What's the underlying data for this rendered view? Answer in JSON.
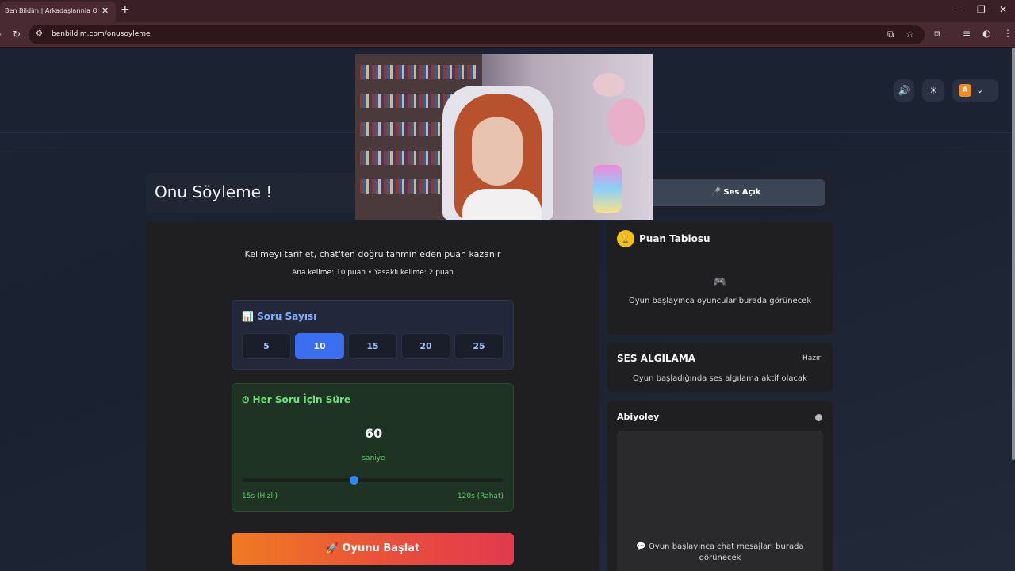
{
  "browser": {
    "tab_title": "Ben Bildim | Arkadaşlarınla Onl",
    "tab_close": "✕",
    "new_tab": "+",
    "url": "benbildim.com/onusoyleme",
    "minimize": "—",
    "maximize": "❐",
    "close": "✕"
  },
  "header": {
    "volume_icon": "🔊",
    "theme_icon": "☀",
    "avatar_letter": "A",
    "chevron": "⌄"
  },
  "game": {
    "title": "Onu Söyleme !",
    "instruction": "Kelimeyi tarif et, chat'ten doğru tahmin eden puan kazanır",
    "points_info": "Ana kelime: 10 puan • Yasaklı kelime: 2 puan",
    "question_count": {
      "title": "📊  Soru Sayısı",
      "options": [
        "5",
        "10",
        "15",
        "20",
        "25"
      ],
      "selected": "10"
    },
    "timer": {
      "title": "⏱  Her Soru İçin Süre",
      "value": "60",
      "unit": "saniye",
      "min": 15,
      "max": 120,
      "min_label": "15s (Hızlı)",
      "max_label": "120s (Rahat)"
    },
    "start_button": "🚀  Oyunu Başlat"
  },
  "sound": {
    "button": "🎤  Ses Açık"
  },
  "scoreboard": {
    "icon": "🏆",
    "title": "Puan Tablosu",
    "empty_icon": "🎮",
    "empty_text": "Oyun başlayınca oyuncular burada görünecek"
  },
  "voice_detection": {
    "title": "SES ALGILAMA",
    "status": "Hazır",
    "text": "Oyun başladığında ses algılama aktif olacak"
  },
  "chat": {
    "title": "Abiyoley",
    "empty_text": "💬 Oyun başlayınca chat mesajları burada görünecek"
  },
  "colors": {
    "accent_blue": "#3b6ff0",
    "timer_green": "#5ed06a",
    "start_orange": "#f07a22",
    "start_red": "#e23a4e"
  }
}
